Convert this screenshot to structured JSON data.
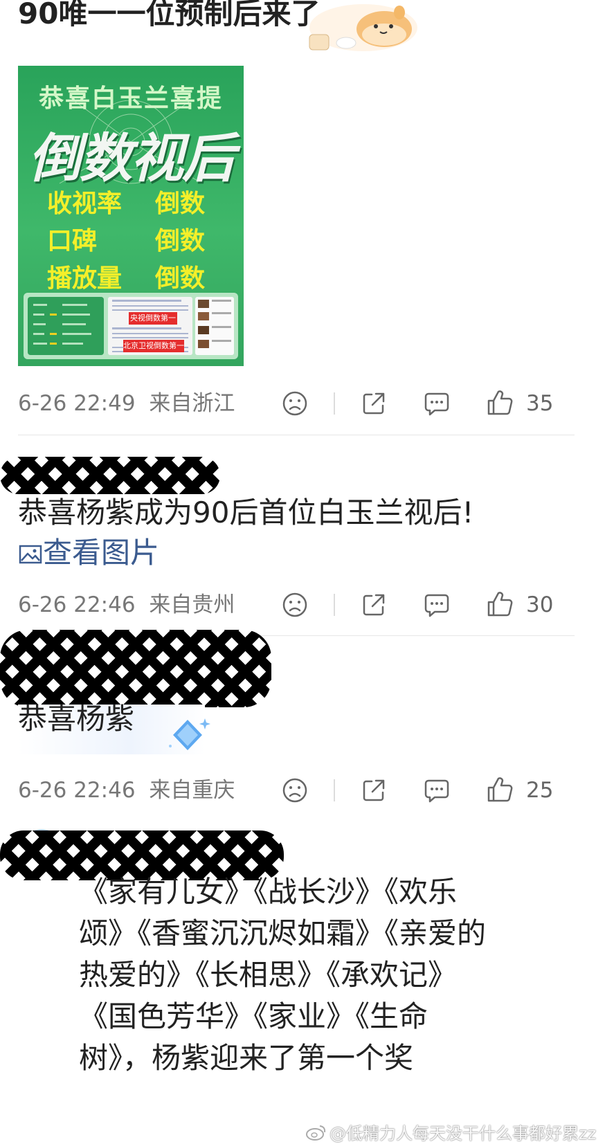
{
  "posts": [
    {
      "text": "90唯一一位预制后来了",
      "image": {
        "line1": "恭喜白玉兰喜提",
        "big": "倒数视后",
        "rows": [
          {
            "left": "收视率",
            "right": "倒数"
          },
          {
            "left": "口碑",
            "right": "倒数"
          },
          {
            "left": "播放量",
            "right": "倒数"
          }
        ],
        "red_label_1": "央视倒数第一",
        "red_label_2": "北京卫视倒数第一"
      },
      "time": "6-26 22:49",
      "location": "来自浙江",
      "likes": "35"
    },
    {
      "text": "恭喜杨紫成为90后首位白玉兰视后!",
      "link": "查看图片",
      "time": "6-26 22:46",
      "location": "来自贵州",
      "likes": "30"
    },
    {
      "text": "恭喜杨紫",
      "time": "6-26 22:46",
      "location": "来自重庆",
      "likes": "25"
    },
    {
      "lines": [
        "《家有儿女》《战长沙》《欢乐",
        "颂》《香蜜沉沉烬如霜》《亲爱的",
        "热爱的》《长相思》《承欢记》",
        "《国色芳华》《家业》《生命",
        "树》，杨紫迎来了第一个奖"
      ]
    }
  ],
  "watermark": "@低精力人每天没干什么事都好累zz",
  "icons": {
    "dislike": "sad-face-icon",
    "share": "share-icon",
    "comment": "comment-icon",
    "like": "thumbs-up-icon",
    "image": "image-icon",
    "sticker": "bread-dog-sticker-icon",
    "diamond": "diamond-sticker-icon"
  },
  "colors": {
    "link": "#3b5b8f",
    "meta": "#777777",
    "poster_green": "#3fb86a",
    "poster_yellow": "#f4ef2a"
  }
}
